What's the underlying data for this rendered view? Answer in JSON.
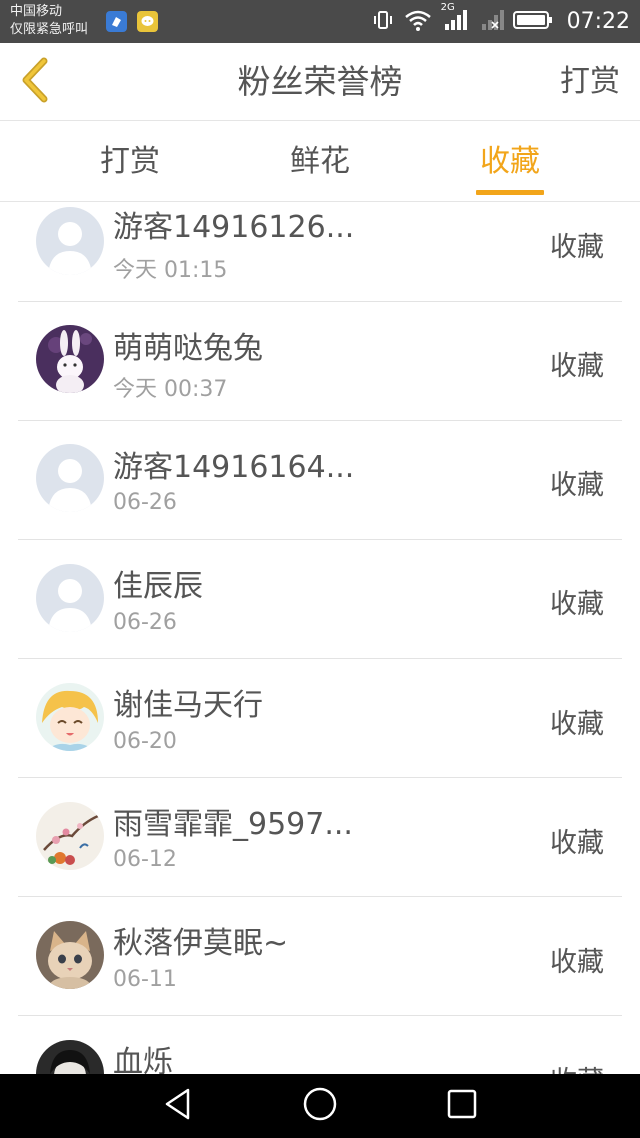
{
  "status_bar": {
    "carrier_line1": "中国移动",
    "carrier_line2": "仅限紧急呼叫",
    "network": "2G",
    "time": "07:22"
  },
  "header": {
    "back_icon": "chevron-left-icon",
    "title": "粉丝荣誉榜",
    "action_label": "打赏"
  },
  "tabs": [
    {
      "label": "打赏",
      "active": false
    },
    {
      "label": "鲜花",
      "active": false
    },
    {
      "label": "收藏",
      "active": true
    }
  ],
  "fans": [
    {
      "name": "游客14916126...",
      "time": "今天 01:15",
      "action": "收藏",
      "avatar": "default-avatar"
    },
    {
      "name": "萌萌哒兔兔",
      "time": "今天 00:37",
      "action": "收藏",
      "avatar": "rabbit-avatar"
    },
    {
      "name": "游客14916164...",
      "time": "06-26",
      "action": "收藏",
      "avatar": "default-avatar"
    },
    {
      "name": "佳辰辰",
      "time": "06-26",
      "action": "收藏",
      "avatar": "default-avatar"
    },
    {
      "name": "谢佳马天行",
      "time": "06-20",
      "action": "收藏",
      "avatar": "anime-avatar"
    },
    {
      "name": "雨雪霏霏_9597...",
      "time": "06-12",
      "action": "收藏",
      "avatar": "flower-painting-avatar"
    },
    {
      "name": "秋落伊莫眠~",
      "time": "06-11",
      "action": "收藏",
      "avatar": "kitten-avatar"
    },
    {
      "name": "血烁",
      "time": "",
      "action": "收藏",
      "avatar": "dark-avatar"
    }
  ],
  "colors": {
    "accent": "#f2a51a",
    "status_bar": "#4a4a4a",
    "text": "#555555",
    "subtext": "#a0a0a0"
  }
}
